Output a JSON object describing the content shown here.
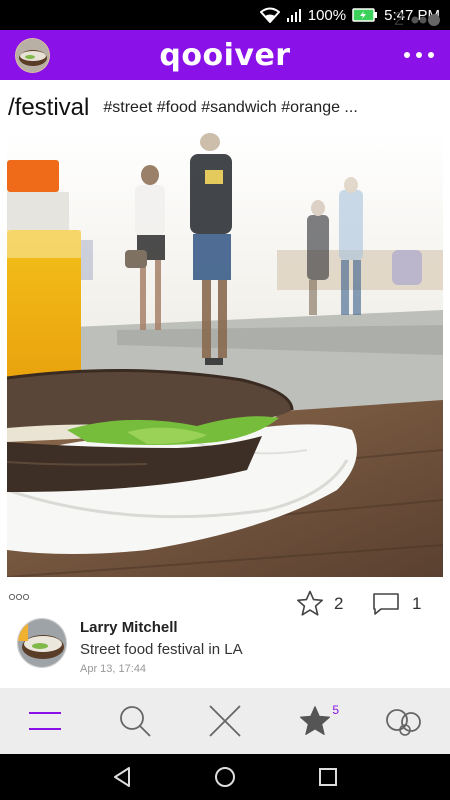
{
  "status_bar": {
    "battery": "100%",
    "time": "5:47 PM"
  },
  "app": {
    "title": "qooiver",
    "accent": "#8a12e9"
  },
  "post": {
    "channel": "/festival",
    "tags": "#street #food #sandwich #orange ...",
    "count": "2",
    "likes": "2",
    "comments": "1",
    "author": "Larry Mitchell",
    "caption": "Street food festival in LA",
    "time": "Apr 13, 17:44"
  },
  "tabs": {
    "menu": "menu-icon",
    "search": "search-icon",
    "close": "close-icon",
    "favorites": "star-icon",
    "favorites_badge": "5",
    "profile": "qooiver-logo-icon"
  },
  "nav": [
    "back-icon",
    "home-icon",
    "recents-icon"
  ]
}
